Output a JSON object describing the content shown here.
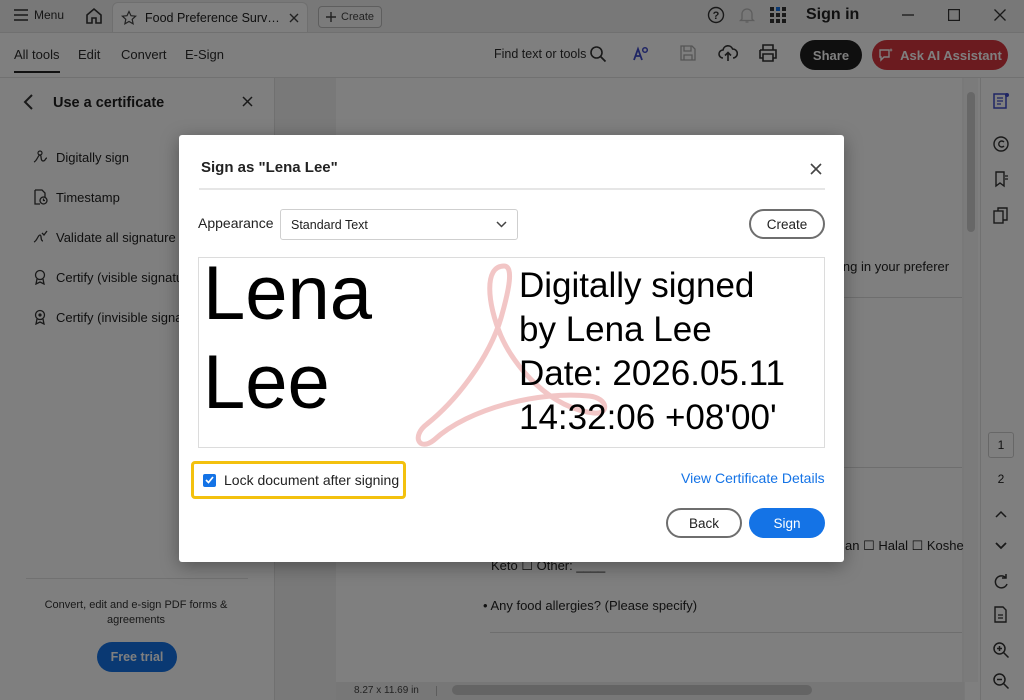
{
  "titlebar": {
    "menu_label": "Menu",
    "tab_title": "Food Preference Survey...",
    "create_label": "Create",
    "signin_label": "Sign in"
  },
  "toolbar": {
    "menus": [
      "All tools",
      "Edit",
      "Convert",
      "E-Sign"
    ],
    "find_label": "Find text or tools",
    "share_label": "Share",
    "ai_label": "Ask AI Assistant"
  },
  "left_panel": {
    "title": "Use a certificate",
    "items": [
      "Digitally sign",
      "Timestamp",
      "Validate all signature",
      "Certify (visible signature)",
      "Certify (invisible signature)"
    ],
    "promo_text": "Convert, edit and e-sign PDF forms & agreements",
    "free_trial_label": "Free trial"
  },
  "document": {
    "line1": "ing in your preferer",
    "line2": "an ☐ Halal ☐ Koshe",
    "line3": "Keto ☐ Other: ____",
    "line4": "• Any food allergies? (Please specify)",
    "page_size": "8.27 x 11.69 in"
  },
  "right_rail": {
    "page_current": "1",
    "page_next": "2"
  },
  "dialog": {
    "title": "Sign as \"Lena Lee\"",
    "appearance_label": "Appearance",
    "appearance_value": "Standard Text",
    "create_label": "Create",
    "signature_name": [
      "Lena",
      "Lee"
    ],
    "signature_details": [
      "Digitally signed",
      "by Lena Lee",
      "Date: 2026.05.11",
      "14:32:06 +08'00'"
    ],
    "lock_label": "Lock document after signing",
    "lock_checked": true,
    "view_cert_label": "View Certificate Details",
    "back_label": "Back",
    "sign_label": "Sign"
  },
  "colors": {
    "accent": "#1473e6",
    "ai_button": "#d7373f",
    "highlight": "#f3c10e"
  }
}
